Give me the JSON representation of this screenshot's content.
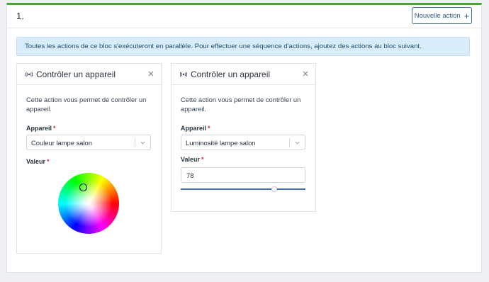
{
  "block": {
    "number": "1.",
    "new_action_label": "Nouvelle action",
    "accent_color": "#47a52f"
  },
  "info_banner": {
    "text": "Toutes les actions de ce bloc s'exécuteront en parallèle. Pour effectuer une séquence d'actions, ajoutez des actions au bloc suivant."
  },
  "cards": [
    {
      "icon": "device-signal-icon",
      "title": "Contrôler un appareil",
      "description": "Cette action vous permet de contrôler un appareil.",
      "device_label": "Appareil",
      "device_value": "Couleur lampe salon",
      "value_label": "Valeur",
      "value_type": "color-wheel"
    },
    {
      "icon": "device-signal-icon",
      "title": "Contrôler un appareil",
      "description": "Cette action vous permet de contrôler un appareil.",
      "device_label": "Appareil",
      "device_value": "Luminosité lampe salon",
      "value_label": "Valeur",
      "value_type": "number-slider",
      "value": "78",
      "slider_fraction": 0.75
    }
  ],
  "required_marker": "*",
  "colors": {
    "primary": "#3b6e9e",
    "required": "#d7263d",
    "banner_bg": "#d9ecf9"
  }
}
